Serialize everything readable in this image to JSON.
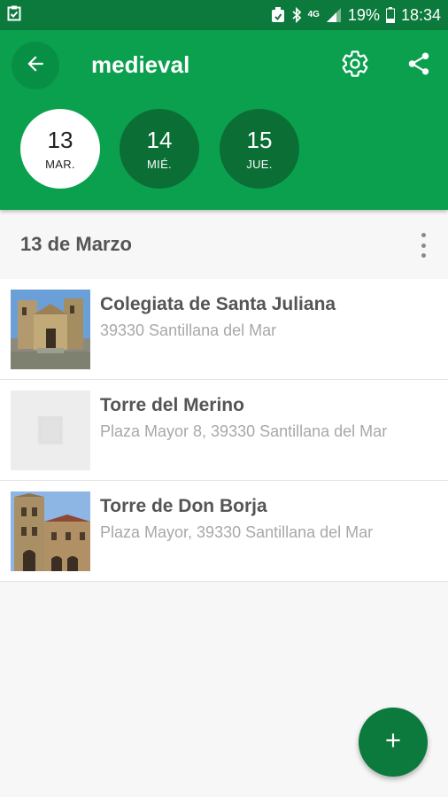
{
  "status_bar": {
    "left_icon": "clipboard-check-icon",
    "network": "4G",
    "battery": "19%",
    "time": "18:34"
  },
  "app_bar": {
    "title": "medieval",
    "back_icon": "arrow-back-icon",
    "settings_icon": "gear-icon",
    "share_icon": "share-icon",
    "colors": {
      "primary": "#0aa04e",
      "dark": "#0b7a3c",
      "chip": "#0b6e35"
    }
  },
  "days": [
    {
      "num": "13",
      "abbr": "MAR.",
      "selected": true
    },
    {
      "num": "14",
      "abbr": "MIÉ.",
      "selected": false
    },
    {
      "num": "15",
      "abbr": "JUE.",
      "selected": false
    }
  ],
  "section": {
    "title": "13 de Marzo",
    "menu_icon": "more-vertical-icon"
  },
  "places": [
    {
      "name": "Colegiata de Santa Juliana",
      "address": "39330 Santillana del Mar",
      "image": "church-photo"
    },
    {
      "name": "Torre del Merino",
      "address": "Plaza Mayor 8, 39330 Santillana del Mar",
      "image": "placeholder-image"
    },
    {
      "name": "Torre de Don Borja",
      "address": "Plaza Mayor, 39330 Santillana del Mar",
      "image": "tower-photo"
    }
  ],
  "fab": {
    "icon": "plus-icon"
  }
}
